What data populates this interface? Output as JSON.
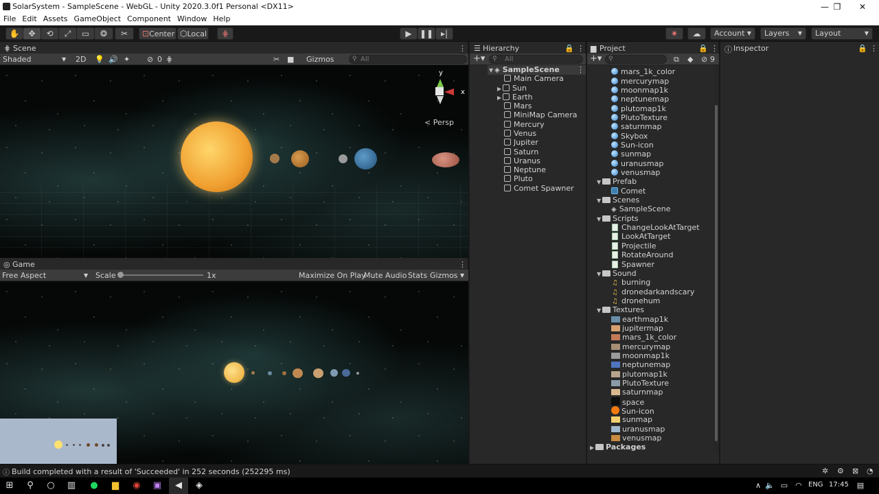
{
  "window": {
    "title": "SolarSystem - SampleScene - WebGL - Unity 2020.3.0f1 Personal <DX11>",
    "minimize": "—",
    "maximize": "❐",
    "close": "✕"
  },
  "menu": [
    "File",
    "Edit",
    "Assets",
    "GameObject",
    "Component",
    "Window",
    "Help"
  ],
  "toolbar": {
    "pivot": "Center",
    "space": "Local",
    "account": "Account",
    "layers": "Layers",
    "layout": "Layout"
  },
  "scene": {
    "tab": "Scene",
    "shading": "Shaded",
    "mode2d": "2D",
    "hidden_count": "0",
    "gizmos": "Gizmos",
    "search_placeholder": "All",
    "axis_y": "y",
    "axis_x": "x",
    "projection": "< Persp"
  },
  "game": {
    "tab": "Game",
    "aspect": "Free Aspect",
    "scale_label": "Scale",
    "scale_value": "1x",
    "buttons": [
      "Maximize On Play",
      "Mute Audio",
      "Stats",
      "Gizmos"
    ]
  },
  "hierarchy": {
    "tab": "Hierarchy",
    "search_placeholder": "All",
    "scene": "SampleScene",
    "items": [
      "Main Camera",
      "Sun",
      "Earth",
      "Mars",
      "MiniMap Camera",
      "Mercury",
      "Venus",
      "Jupiter",
      "Saturn",
      "Uranus",
      "Neptune",
      "Pluto",
      "Comet Spawner"
    ]
  },
  "project": {
    "tab": "Project",
    "hidden_count": "9",
    "materials": [
      "mars_1k_color",
      "mercurymap",
      "moonmap1k",
      "neptunemap",
      "plutomap1k",
      "PlutoTexture",
      "saturnmap",
      "Skybox",
      "Sun-icon",
      "sunmap",
      "uranusmap",
      "venusmap"
    ],
    "prefab_folder": "Prefab",
    "prefab_items": [
      "Comet"
    ],
    "scenes_folder": "Scenes",
    "scenes_items": [
      "SampleScene"
    ],
    "scripts_folder": "Scripts",
    "scripts_items": [
      "ChangeLookAtTarget",
      "LookAtTarget",
      "Projectile",
      "RotateAround",
      "Spawner"
    ],
    "sound_folder": "Sound",
    "sound_items": [
      "burning",
      "dronedarkandscary",
      "dronehum"
    ],
    "textures_folder": "Textures",
    "textures_items": [
      "earthmap1k",
      "jupitermap",
      "mars_1k_color",
      "mercurymap",
      "moonmap1k",
      "neptunemap",
      "plutomap1k",
      "PlutoTexture",
      "saturnmap",
      "space",
      "Sun-icon",
      "sunmap",
      "uranusmap",
      "venusmap"
    ],
    "packages": "Packages"
  },
  "inspector": {
    "tab": "Inspector"
  },
  "status": {
    "message": "Build completed with a result of 'Succeeded' in 252 seconds (252295 ms)"
  },
  "taskbar": {
    "language": "ENG",
    "time": "17:45"
  }
}
